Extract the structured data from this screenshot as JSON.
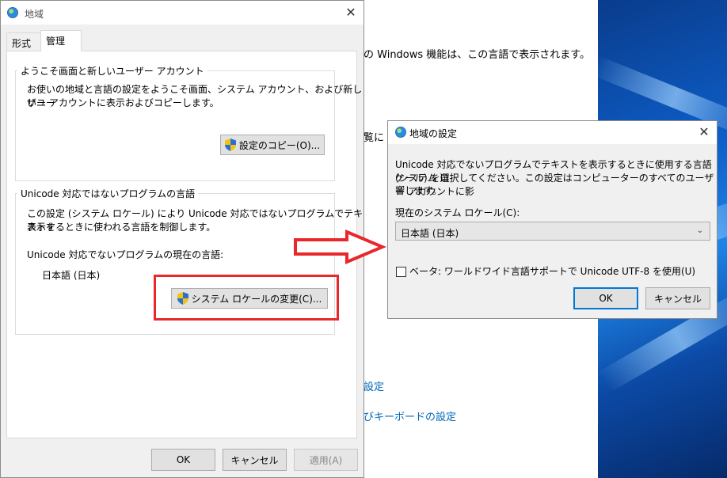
{
  "background_window": {
    "text_line1": "の Windows 機能は、この言語で表示されます。",
    "text_line2": "覧に",
    "link1": "設定",
    "link2": "びキーボードの設定"
  },
  "region_dialog": {
    "title": "地域",
    "close_symbol": "✕",
    "tabs": [
      {
        "label": "形式"
      },
      {
        "label": "管理"
      }
    ],
    "welcome_group": {
      "title": "ようこそ画面と新しいユーザー アカウント",
      "line1": "お使いの地域と言語の設定をようこそ画面、システム アカウント、および新しいユー",
      "line2": "ザー アカウントに表示およびコピーします。",
      "copy_button": "設定のコピー(O)..."
    },
    "unicode_group": {
      "title": "Unicode 対応ではないプログラムの言語",
      "line1": "この設定 (システム ロケール) により Unicode 対応ではないプログラムでテキストを",
      "line2": "表示するときに使われる言語を制御します。",
      "current_label": "Unicode 対応でないプログラムの現在の言語:",
      "current_value": "日本語 (日本)",
      "change_button": "システム ロケールの変更(C)..."
    },
    "footer": {
      "ok": "OK",
      "cancel": "キャンセル",
      "apply": "適用(A)"
    }
  },
  "region_settings_dialog": {
    "title": "地域の設定",
    "close_symbol": "✕",
    "desc_line1": "Unicode 対応でないプログラムでテキストを表示するときに使用する言語 (システム ロ",
    "desc_line2": "ケール) を選択してください。この設定はコンピューターのすべてのユーザー アカウントに影",
    "desc_line3": "響します。",
    "locale_label": "現在のシステム ロケール(C):",
    "locale_value": "日本語 (日本)",
    "beta_checkbox_label": "ベータ: ワールドワイド言語サポートで Unicode UTF-8 を使用(U)",
    "beta_checked": false,
    "ok": "OK",
    "cancel": "キャンセル"
  },
  "colors": {
    "highlight": "#e8282b",
    "link": "#0067b8",
    "accent": "#0078d7"
  }
}
